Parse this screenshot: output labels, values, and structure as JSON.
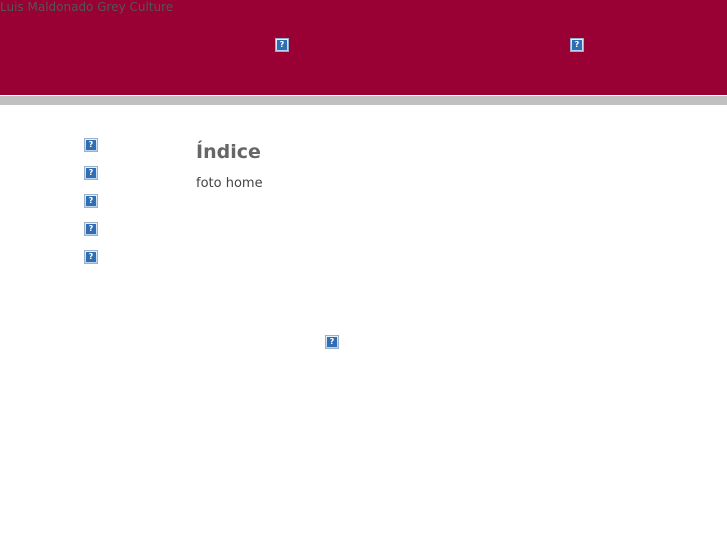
{
  "header": {
    "title": "Luis Maldonado Grey Culture",
    "background_color": "#990033",
    "images": [
      {
        "icon": "broken-image-icon",
        "glyph": "?"
      },
      {
        "icon": "broken-image-icon",
        "glyph": "?"
      }
    ]
  },
  "band": {
    "color": "#c0c0c0"
  },
  "sidebar": {
    "items": [
      {
        "icon": "broken-image-icon",
        "glyph": "?"
      },
      {
        "icon": "broken-image-icon",
        "glyph": "?"
      },
      {
        "icon": "broken-image-icon",
        "glyph": "?"
      },
      {
        "icon": "broken-image-icon",
        "glyph": "?"
      },
      {
        "icon": "broken-image-icon",
        "glyph": "?"
      }
    ]
  },
  "main": {
    "heading": "Índice",
    "text": "foto home"
  },
  "footer": {
    "image": {
      "icon": "broken-image-icon",
      "glyph": "?"
    }
  }
}
